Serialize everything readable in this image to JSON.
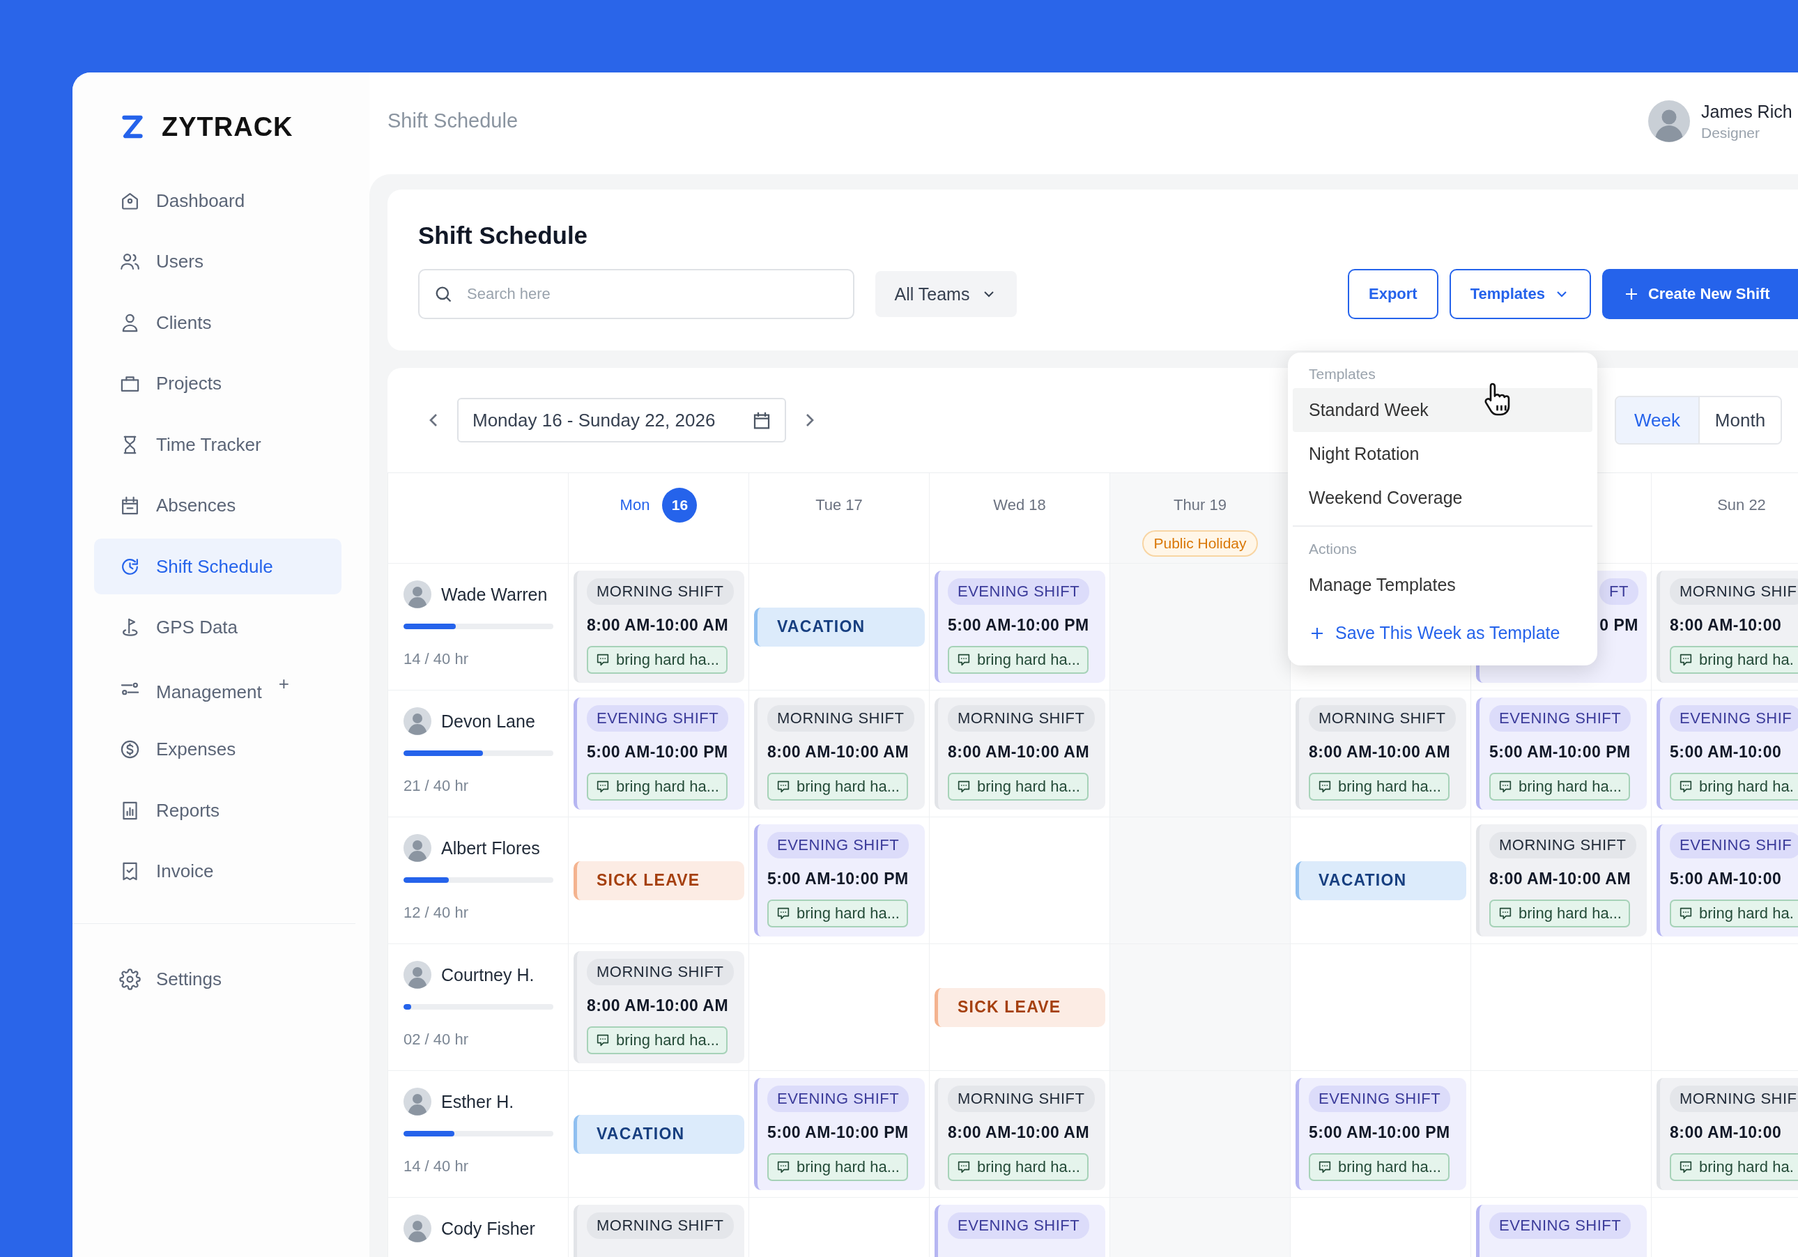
{
  "brand": {
    "name": "ZYTRACK"
  },
  "sidebar": {
    "items": [
      {
        "label": "Dashboard",
        "selected": false
      },
      {
        "label": "Users",
        "selected": false
      },
      {
        "label": "Clients",
        "selected": false
      },
      {
        "label": "Projects",
        "selected": false
      },
      {
        "label": "Time Tracker",
        "selected": false
      },
      {
        "label": "Absences",
        "selected": false
      },
      {
        "label": "Shift Schedule",
        "selected": true
      },
      {
        "label": "GPS Data",
        "selected": false
      },
      {
        "label": "Management",
        "selected": false,
        "badge": "+"
      },
      {
        "label": "Expenses",
        "selected": false
      },
      {
        "label": "Reports",
        "selected": false
      },
      {
        "label": "Invoice",
        "selected": false
      }
    ],
    "footer": [
      {
        "label": "Settings",
        "selected": false
      }
    ]
  },
  "header": {
    "title": "Shift Schedule",
    "user": {
      "name": "James Rich",
      "role": "Designer"
    }
  },
  "toolbar": {
    "title": "Shift Schedule",
    "search": {
      "placeholder": "Search here"
    },
    "team_filter": "All Teams",
    "buttons": [
      {
        "label": "Export",
        "kind": "outline"
      },
      {
        "label": "Templates",
        "kind": "dropdown"
      },
      {
        "label": "Create New Shift",
        "kind": "primary"
      }
    ]
  },
  "schedule": {
    "date_range": "Monday 16 - Sunday 22, 2026",
    "views": [
      {
        "label": "Week",
        "selected": true
      },
      {
        "label": "Month",
        "selected": false
      }
    ],
    "days": [
      {
        "label": "Mon",
        "date": "16",
        "today": true
      },
      {
        "label": "Tue 17",
        "today": false
      },
      {
        "label": "Wed 18",
        "today": false
      },
      {
        "label": "Thur 19",
        "today": false,
        "holiday": "Public Holiday"
      }
    ],
    "days_right": [
      {
        "label": "Sun 22",
        "today": false
      }
    ],
    "rows": [
      {
        "name": "Wade Warren",
        "hours": "14 / 40 hr",
        "level": 0.35,
        "shifts": [
          {
            "kind": "morning",
            "label": "MORNING SHIFT",
            "time": "8:00 AM-10:00 AM",
            "note": "bring hard ha..."
          },
          {
            "kind": "vacation",
            "label": "VACATION"
          },
          {
            "kind": "evening",
            "label": "EVENING SHIFT",
            "time": "5:00 AM-10:00 PM",
            "note": "bring hard ha..."
          },
          {
            "kind": "empty"
          },
          {
            "kind": "empty"
          },
          {
            "kind": "evening",
            "label": "FT",
            "time": "0 PM",
            "covered": true
          },
          {
            "kind": "morning",
            "label": "MORNING SHIF",
            "time": "8:00 AM-10:00",
            "note": "bring hard ha."
          }
        ]
      },
      {
        "name": "Devon Lane",
        "hours": "21 / 40 hr",
        "level": 0.53,
        "shifts": [
          {
            "kind": "evening",
            "label": "EVENING SHIFT",
            "time": "5:00 AM-10:00 PM",
            "note": "bring hard ha..."
          },
          {
            "kind": "morning",
            "label": "MORNING SHIFT",
            "time": "8:00 AM-10:00 AM",
            "note": "bring hard ha..."
          },
          {
            "kind": "morning",
            "label": "MORNING SHIFT",
            "time": "8:00 AM-10:00 AM",
            "note": "bring hard ha..."
          },
          {
            "kind": "empty"
          },
          {
            "kind": "morning",
            "label": "MORNING SHIFT",
            "time": "8:00 AM-10:00 AM",
            "note": "bring hard ha..."
          },
          {
            "kind": "evening",
            "label": "EVENING SHIFT",
            "time": "5:00 AM-10:00 PM",
            "note": "bring hard ha..."
          },
          {
            "kind": "evening",
            "label": "EVENING SHIF",
            "time": "5:00 AM-10:00",
            "note": "bring hard ha."
          }
        ]
      },
      {
        "name": "Albert Flores",
        "hours": "12 / 40 hr",
        "level": 0.3,
        "shifts": [
          {
            "kind": "sick",
            "label": "SICK LEAVE"
          },
          {
            "kind": "evening",
            "label": "EVENING SHIFT",
            "time": "5:00 AM-10:00 PM",
            "note": "bring hard ha..."
          },
          {
            "kind": "empty"
          },
          {
            "kind": "empty"
          },
          {
            "kind": "vacation",
            "label": "VACATION"
          },
          {
            "kind": "morning",
            "label": "MORNING SHIFT",
            "time": "8:00 AM-10:00 AM",
            "note": "bring hard ha..."
          },
          {
            "kind": "evening",
            "label": "EVENING SHIF",
            "time": "5:00 AM-10:00",
            "note": "bring hard ha."
          }
        ]
      },
      {
        "name": "Courtney H.",
        "hours": "02 / 40 hr",
        "level": 0.05,
        "shifts": [
          {
            "kind": "morning",
            "label": "MORNING SHIFT",
            "time": "8:00 AM-10:00 AM",
            "note": "bring hard ha..."
          },
          {
            "kind": "empty"
          },
          {
            "kind": "sick",
            "label": "SICK LEAVE"
          },
          {
            "kind": "empty"
          },
          {
            "kind": "empty"
          },
          {
            "kind": "empty"
          },
          {
            "kind": "empty"
          }
        ]
      },
      {
        "name": "Esther H.",
        "hours": "14 / 40 hr",
        "level": 0.34,
        "shifts": [
          {
            "kind": "vacation",
            "label": "VACATION"
          },
          {
            "kind": "evening",
            "label": "EVENING SHIFT",
            "time": "5:00 AM-10:00 PM",
            "note": "bring hard ha..."
          },
          {
            "kind": "morning",
            "label": "MORNING SHIFT",
            "time": "8:00 AM-10:00 AM",
            "note": "bring hard ha..."
          },
          {
            "kind": "empty"
          },
          {
            "kind": "evening",
            "label": "EVENING SHIFT",
            "time": "5:00 AM-10:00 PM",
            "note": "bring hard ha..."
          },
          {
            "kind": "empty"
          },
          {
            "kind": "morning",
            "label": "MORNING SHIF",
            "time": "8:00 AM-10:00",
            "note": "bring hard ha."
          }
        ]
      },
      {
        "name": "Cody Fisher",
        "shifts": [
          {
            "kind": "morning",
            "label": "MORNING SHIFT"
          },
          {
            "kind": "empty"
          },
          {
            "kind": "evening",
            "label": "EVENING SHIFT"
          },
          {
            "kind": "empty"
          },
          {
            "kind": "empty"
          },
          {
            "kind": "evening",
            "label": "EVENING SHIFT"
          },
          {
            "kind": "empty"
          }
        ]
      }
    ]
  },
  "templates_menu": {
    "sections": [
      {
        "title": "Templates",
        "items": [
          {
            "label": "Standard Week",
            "kind": "item",
            "selected": true
          },
          {
            "label": "Night Rotation",
            "kind": "item",
            "selected": false
          },
          {
            "label": "Weekend Coverage",
            "kind": "item",
            "selected": false
          }
        ]
      },
      {
        "title": "Actions",
        "items": [
          {
            "label": "Manage Templates",
            "kind": "item",
            "selected": false
          },
          {
            "label": "Save This Week as Template",
            "kind": "add",
            "selected": false
          }
        ]
      }
    ]
  }
}
